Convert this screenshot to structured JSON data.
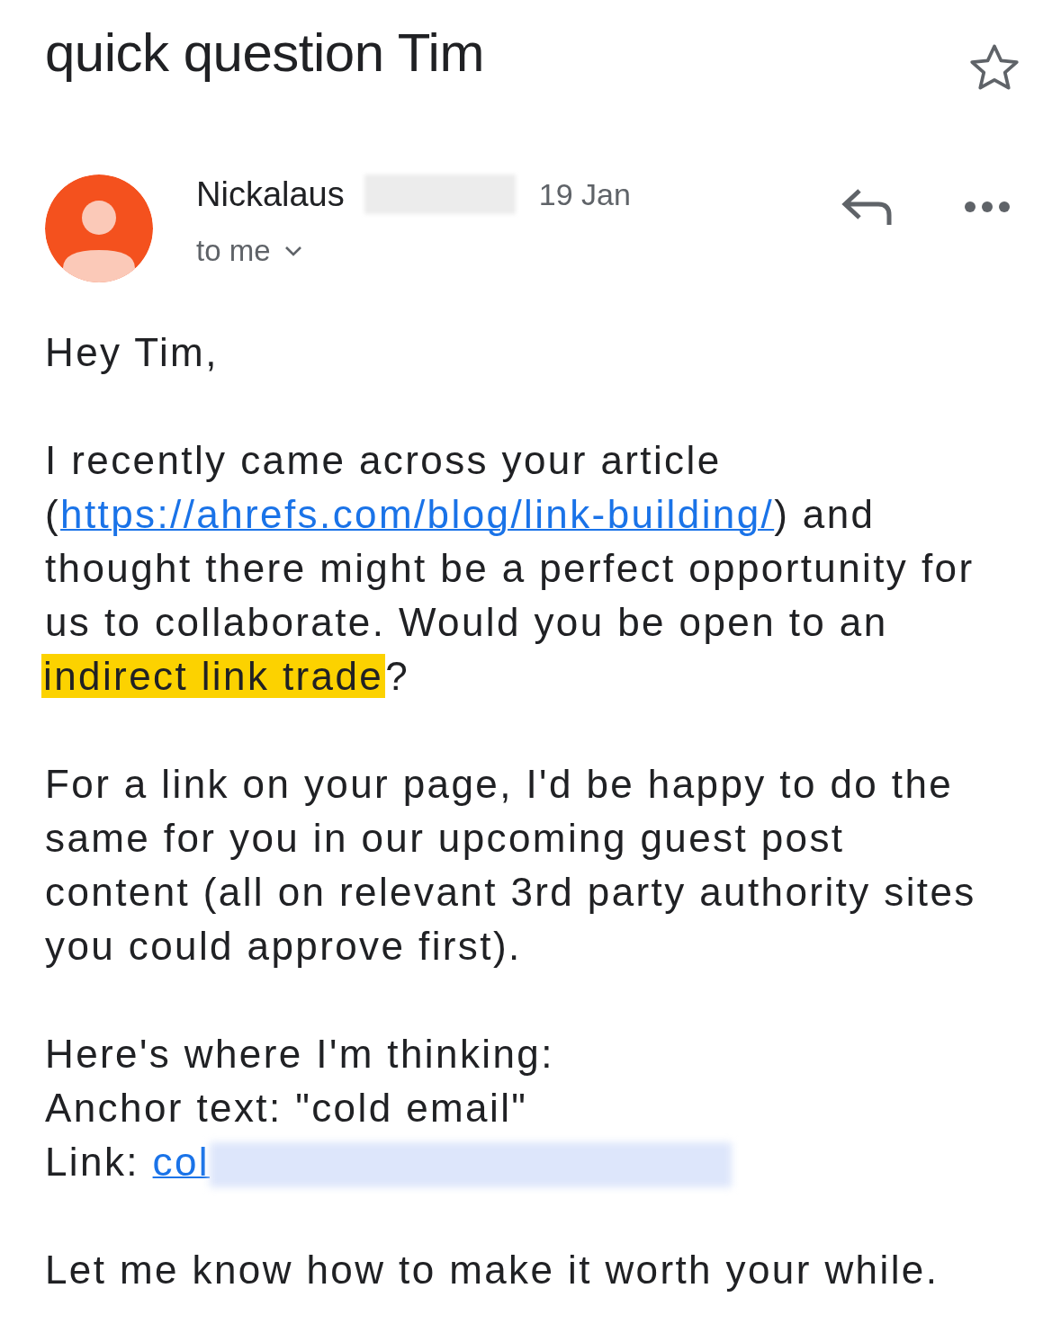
{
  "subject": "quick question Tim",
  "starred": false,
  "sender": {
    "name": "Nickalaus",
    "surname_redacted": true,
    "date": "19 Jan",
    "recipient": "to me"
  },
  "body": [
    [
      {
        "kind": "text",
        "text": "Hey Tim,"
      }
    ],
    [
      {
        "kind": "text",
        "text": "I recently came across your article"
      },
      {
        "kind": "br"
      },
      {
        "kind": "text",
        "text": "("
      },
      {
        "kind": "link",
        "text": "https://ahrefs.com/blog/link-building/"
      },
      {
        "kind": "text",
        "text": ") and"
      },
      {
        "kind": "br"
      },
      {
        "kind": "text",
        "text": "thought there might be a perfect opportunity for"
      },
      {
        "kind": "br"
      },
      {
        "kind": "text",
        "text": "us to collaborate. Would you be open to an"
      },
      {
        "kind": "br"
      },
      {
        "kind": "highlight",
        "text": "indirect link trade"
      },
      {
        "kind": "text",
        "text": "?"
      }
    ],
    [
      {
        "kind": "text",
        "text": "For a link on your page, I'd be happy to do the"
      },
      {
        "kind": "br"
      },
      {
        "kind": "text",
        "text": "same for you in our upcoming guest post"
      },
      {
        "kind": "br"
      },
      {
        "kind": "text",
        "text": "content (all on relevant 3rd party authority sites"
      },
      {
        "kind": "br"
      },
      {
        "kind": "text",
        "text": "you could approve first)."
      }
    ],
    [
      {
        "kind": "text",
        "text": "Here's where I'm thinking:"
      },
      {
        "kind": "br"
      },
      {
        "kind": "text",
        "text": "Anchor text: \"cold email\""
      },
      {
        "kind": "br"
      },
      {
        "kind": "text",
        "text": "Link: "
      },
      {
        "kind": "link",
        "text": "col"
      },
      {
        "kind": "redacted"
      }
    ],
    [
      {
        "kind": "text",
        "text": "Let me know how to make it worth your while."
      }
    ]
  ]
}
